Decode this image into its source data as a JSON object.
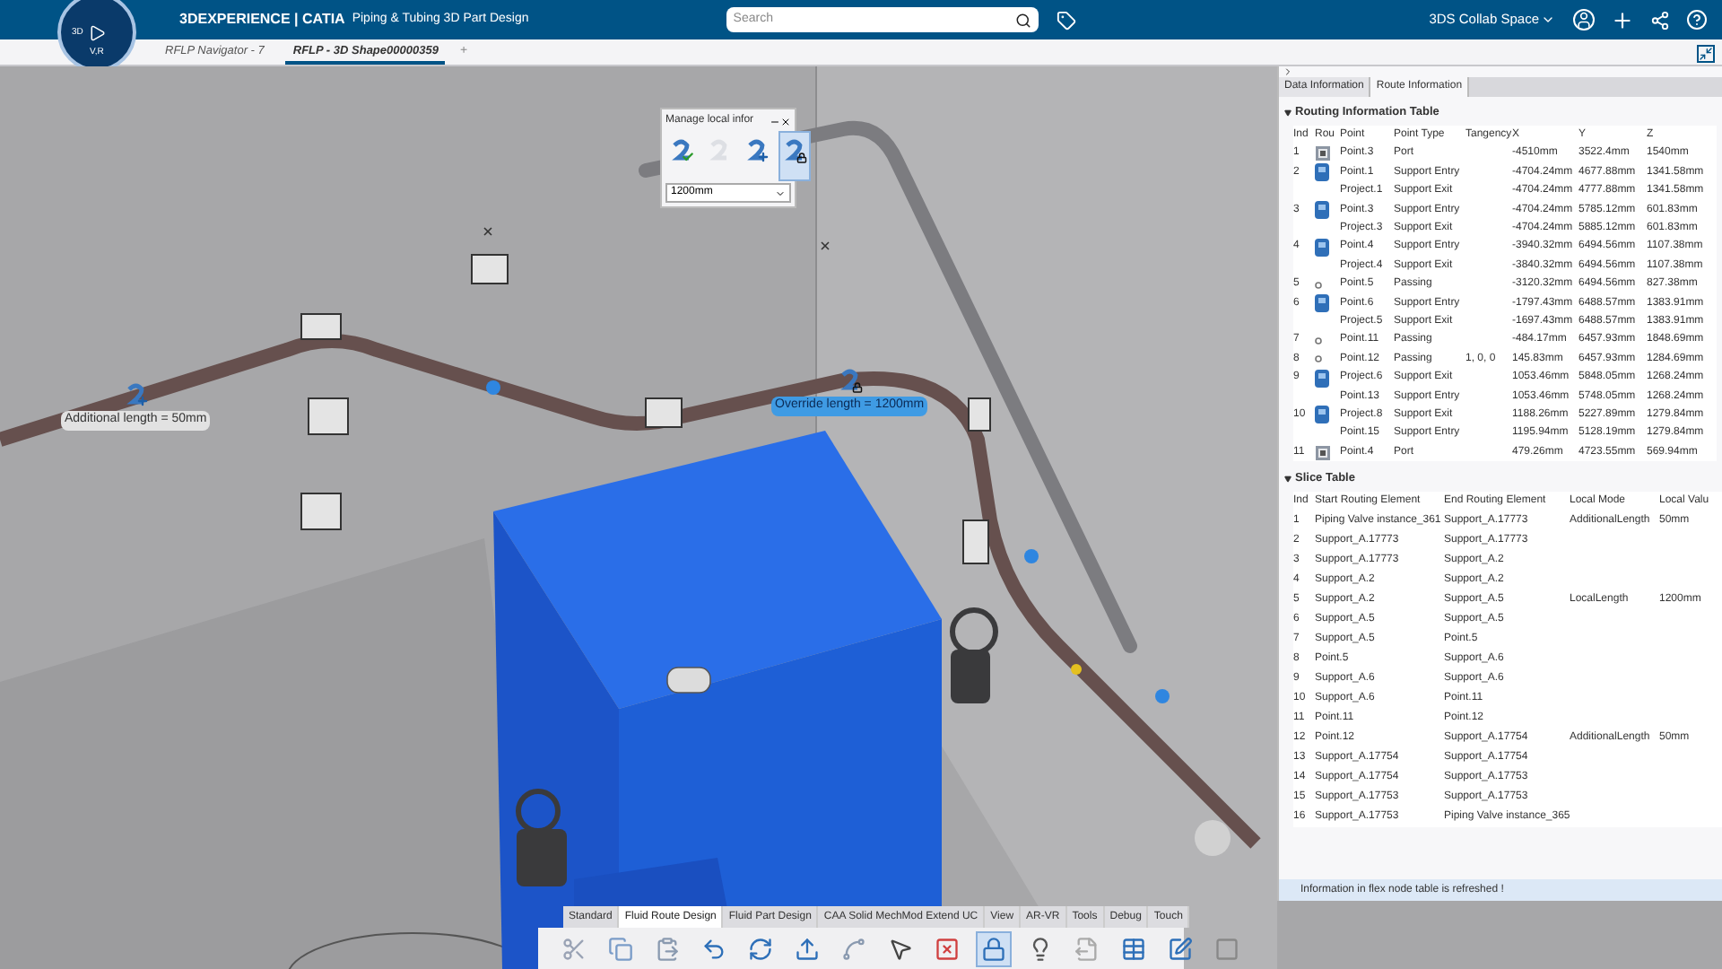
{
  "top_bar": {
    "brand": "3DEXPERIENCE | CATIA",
    "app": "Piping & Tubing 3D Part Design",
    "compass": {
      "left": "3D",
      "bottom": "V,R"
    },
    "search": {
      "placeholder": "Search"
    },
    "space": "3DS Collab Space"
  },
  "tabs": [
    {
      "label": "RFLP Navigator - 7",
      "selected": false
    },
    {
      "label": "RFLP - 3D Shape00000359",
      "selected": true
    }
  ],
  "new_tab": "+",
  "viewport": {
    "labels": [
      {
        "kind": "additional",
        "text": "Additional length = 50mm"
      },
      {
        "kind": "override",
        "text": "Override length = 1200mm"
      }
    ]
  },
  "manage_panel": {
    "title": "Manage local infor",
    "buttons": [
      {
        "kind": "check",
        "selected": false,
        "disabled": false
      },
      {
        "kind": "ghost",
        "selected": false,
        "disabled": true
      },
      {
        "kind": "plus",
        "selected": false,
        "disabled": false
      },
      {
        "kind": "lock",
        "selected": true,
        "disabled": false
      }
    ],
    "value": "1200mm"
  },
  "panel": {
    "tabs": [
      {
        "label": "Data Information",
        "selected": false
      },
      {
        "label": "Route Information",
        "selected": true
      }
    ],
    "routing": {
      "title": "Routing Information Table",
      "expanded": true,
      "columns": [
        "Ind",
        "Rou",
        "Point",
        "Point Type",
        "Tangency",
        "X",
        "Y",
        "Z"
      ],
      "rows": [
        {
          "index": "1",
          "kind": "port",
          "point": "Point.3",
          "type": "Port",
          "tangency": "",
          "x": "-4510mm",
          "y": "3522.4mm",
          "z": "1540mm"
        },
        {
          "index": "2",
          "kind": "support",
          "point": "Point.1",
          "type": "Support Entry",
          "tangency": "",
          "x": "-4704.24mm",
          "y": "4677.88mm",
          "z": "1341.58mm"
        },
        {
          "index": "",
          "kind": "none",
          "point": "Project.1",
          "type": "Support Exit",
          "tangency": "",
          "x": "-4704.24mm",
          "y": "4777.88mm",
          "z": "1341.58mm"
        },
        {
          "index": "3",
          "kind": "support",
          "point": "Point.3",
          "type": "Support Entry",
          "tangency": "",
          "x": "-4704.24mm",
          "y": "5785.12mm",
          "z": "601.83mm"
        },
        {
          "index": "",
          "kind": "none",
          "point": "Project.3",
          "type": "Support Exit",
          "tangency": "",
          "x": "-4704.24mm",
          "y": "5885.12mm",
          "z": "601.83mm"
        },
        {
          "index": "4",
          "kind": "support",
          "point": "Point.4",
          "type": "Support Entry",
          "tangency": "",
          "x": "-3940.32mm",
          "y": "6494.56mm",
          "z": "1107.38mm"
        },
        {
          "index": "",
          "kind": "none",
          "point": "Project.4",
          "type": "Support Exit",
          "tangency": "",
          "x": "-3840.32mm",
          "y": "6494.56mm",
          "z": "1107.38mm"
        },
        {
          "index": "5",
          "kind": "passing",
          "point": "Point.5",
          "type": "Passing",
          "tangency": "",
          "x": "-3120.32mm",
          "y": "6494.56mm",
          "z": "827.38mm"
        },
        {
          "index": "6",
          "kind": "support",
          "point": "Point.6",
          "type": "Support Entry",
          "tangency": "",
          "x": "-1797.43mm",
          "y": "6488.57mm",
          "z": "1383.91mm"
        },
        {
          "index": "",
          "kind": "none",
          "point": "Project.5",
          "type": "Support Exit",
          "tangency": "",
          "x": "-1697.43mm",
          "y": "6488.57mm",
          "z": "1383.91mm"
        },
        {
          "index": "7",
          "kind": "passing",
          "point": "Point.11",
          "type": "Passing",
          "tangency": "",
          "x": "-484.17mm",
          "y": "6457.93mm",
          "z": "1848.69mm"
        },
        {
          "index": "8",
          "kind": "passing",
          "point": "Point.12",
          "type": "Passing",
          "tangency": "1, 0, 0",
          "x": "145.83mm",
          "y": "6457.93mm",
          "z": "1284.69mm"
        },
        {
          "index": "9",
          "kind": "support",
          "point": "Project.6",
          "type": "Support Exit",
          "tangency": "",
          "x": "1053.46mm",
          "y": "5848.05mm",
          "z": "1268.24mm"
        },
        {
          "index": "",
          "kind": "none",
          "point": "Point.13",
          "type": "Support Entry",
          "tangency": "",
          "x": "1053.46mm",
          "y": "5748.05mm",
          "z": "1268.24mm"
        },
        {
          "index": "10",
          "kind": "support",
          "point": "Project.8",
          "type": "Support Exit",
          "tangency": "",
          "x": "1188.26mm",
          "y": "5227.89mm",
          "z": "1279.84mm"
        },
        {
          "index": "",
          "kind": "none",
          "point": "Point.15",
          "type": "Support Entry",
          "tangency": "",
          "x": "1195.94mm",
          "y": "5128.19mm",
          "z": "1279.84mm"
        },
        {
          "index": "11",
          "kind": "port",
          "point": "Point.4",
          "type": "Port",
          "tangency": "",
          "x": "479.26mm",
          "y": "4723.55mm",
          "z": "569.94mm"
        }
      ]
    },
    "slice": {
      "title": "Slice Table",
      "expanded": true,
      "columns": [
        "Ind",
        "Start Routing Element",
        "End Routing Element",
        "Local Mode",
        "Local Valu"
      ],
      "rows": [
        [
          "1",
          "Piping Valve instance_361",
          "Support_A.17773",
          "AdditionalLength",
          "50mm"
        ],
        [
          "2",
          "Support_A.17773",
          "Support_A.17773",
          "",
          ""
        ],
        [
          "3",
          "Support_A.17773",
          "Support_A.2",
          "",
          ""
        ],
        [
          "4",
          "Support_A.2",
          "Support_A.2",
          "",
          ""
        ],
        [
          "5",
          "Support_A.2",
          "Support_A.5",
          "LocalLength",
          "1200mm"
        ],
        [
          "6",
          "Support_A.5",
          "Support_A.5",
          "",
          ""
        ],
        [
          "7",
          "Support_A.5",
          "Point.5",
          "",
          ""
        ],
        [
          "8",
          "Point.5",
          "Support_A.6",
          "",
          ""
        ],
        [
          "9",
          "Support_A.6",
          "Support_A.6",
          "",
          ""
        ],
        [
          "10",
          "Support_A.6",
          "Point.11",
          "",
          ""
        ],
        [
          "11",
          "Point.11",
          "Point.12",
          "",
          ""
        ],
        [
          "12",
          "Point.12",
          "Support_A.17754",
          "AdditionalLength",
          "50mm"
        ],
        [
          "13",
          "Support_A.17754",
          "Support_A.17754",
          "",
          ""
        ],
        [
          "14",
          "Support_A.17754",
          "Support_A.17753",
          "",
          ""
        ],
        [
          "15",
          "Support_A.17753",
          "Support_A.17753",
          "",
          ""
        ],
        [
          "16",
          "Support_A.17753",
          "Piping Valve instance_365",
          "",
          ""
        ]
      ]
    },
    "status": "Information in flex node table is refreshed !"
  },
  "toolbar": {
    "tabs": [
      {
        "label": "Standard",
        "selected": false
      },
      {
        "label": "Fluid Route Design",
        "selected": true
      },
      {
        "label": "Fluid Part Design",
        "selected": false
      },
      {
        "label": "CAA Solid MechMod Extend UC",
        "selected": false
      },
      {
        "label": "View",
        "selected": false
      },
      {
        "label": "AR-VR",
        "selected": false
      },
      {
        "label": "Tools",
        "selected": false
      },
      {
        "label": "Debug",
        "selected": false
      },
      {
        "label": "Touch",
        "selected": false
      }
    ],
    "buttons": [
      {
        "kind": "cut",
        "selected": false
      },
      {
        "kind": "copy",
        "selected": false
      },
      {
        "kind": "paste",
        "selected": false
      },
      {
        "kind": "undo",
        "selected": false
      },
      {
        "kind": "update",
        "selected": false
      },
      {
        "kind": "export",
        "selected": false
      },
      {
        "kind": "route",
        "selected": false
      },
      {
        "kind": "pointer",
        "selected": false
      },
      {
        "kind": "delete",
        "selected": false
      },
      {
        "kind": "manage",
        "selected": true
      },
      {
        "kind": "bulb",
        "selected": false
      },
      {
        "kind": "file",
        "selected": false
      },
      {
        "kind": "table",
        "selected": false
      },
      {
        "kind": "edit",
        "selected": false
      },
      {
        "kind": "square",
        "selected": false
      }
    ]
  }
}
